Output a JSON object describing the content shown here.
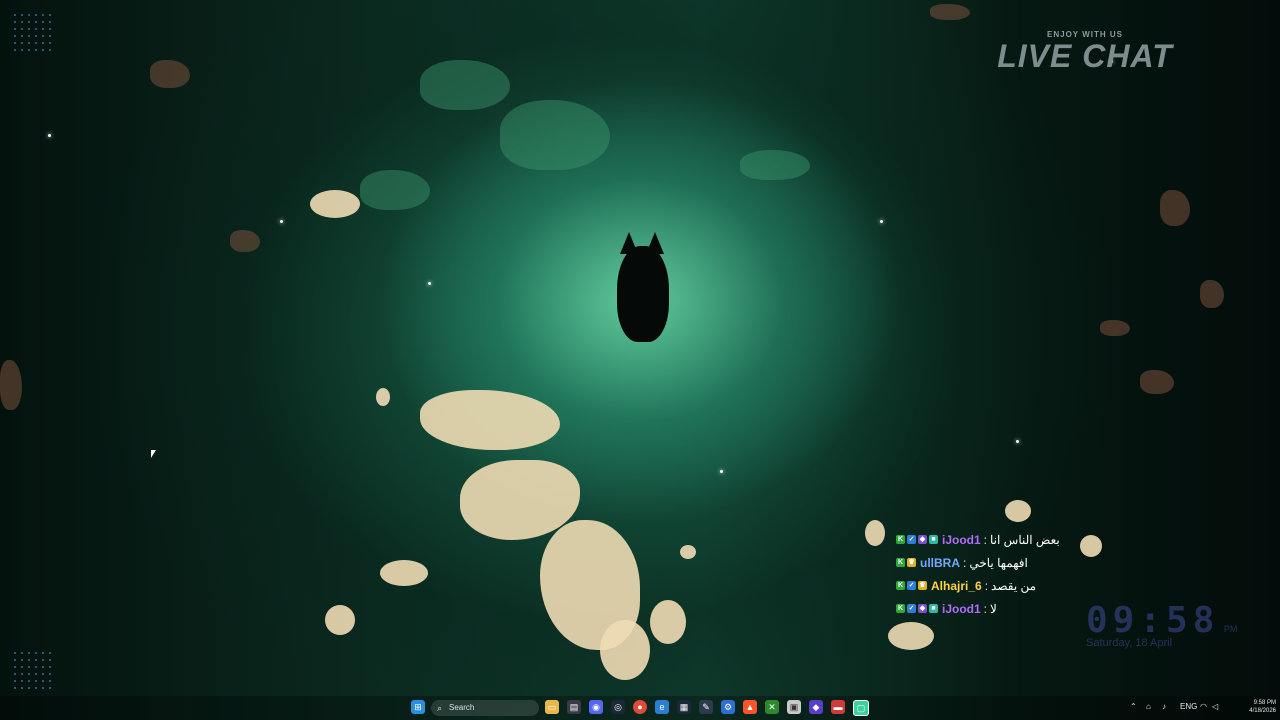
{
  "overlay": {
    "subtitle": "ENJOY WITH US",
    "title": "LIVE CHAT"
  },
  "chat": {
    "messages": [
      {
        "user": "iJood1",
        "user_color": "#b06cff",
        "message": "بعض الناس انا",
        "badges": [
          "k",
          "a",
          "s",
          "c"
        ]
      },
      {
        "user": "ullBRA",
        "user_color": "#6fa8ff",
        "message": "افهمها ياخي",
        "badges": [
          "k",
          "w"
        ]
      },
      {
        "user": "Alhajri_6",
        "user_color": "#ffd24a",
        "message": "من يقصد",
        "badges": [
          "k",
          "a",
          "w"
        ]
      },
      {
        "user": "iJood1",
        "user_color": "#b06cff",
        "message": "لا",
        "badges": [
          "k",
          "a",
          "s",
          "c"
        ]
      }
    ]
  },
  "clock_widget": {
    "time": "09:58",
    "ampm": "PM",
    "date": "Saturday, 18 April"
  },
  "taskbar": {
    "search_placeholder": "Search",
    "language": "ENG",
    "time": "9:58 PM",
    "date": "4/18/2026",
    "pinned_icons": [
      "windows-start-icon",
      "file-explorer-icon",
      "store-icon",
      "discord-icon",
      "steam-icon",
      "chrome-icon",
      "edge-icon",
      "steam-link-icon",
      "notepad-icon",
      "settings-icon",
      "app-icon",
      "brave-icon",
      "xbox-icon",
      "app-icon",
      "app-icon",
      "app-icon",
      "app-icon",
      "app-icon"
    ]
  },
  "colors": {
    "accent": "#2fd0a0",
    "chat_separator": "#e8e8e8"
  }
}
